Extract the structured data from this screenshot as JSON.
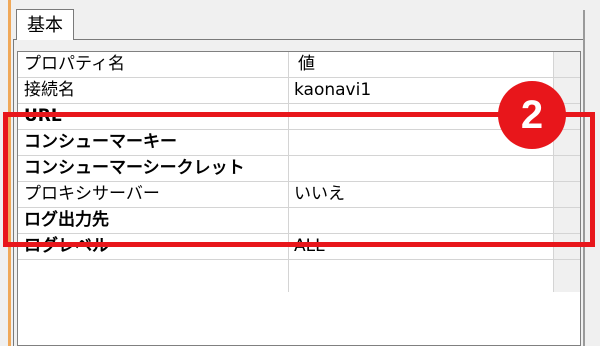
{
  "tab": {
    "label": "基本"
  },
  "header": {
    "name": "プロパティ名",
    "value": "値"
  },
  "rows": [
    {
      "name": "接続名",
      "value": "kaonavi1"
    },
    {
      "name": "URL",
      "value": ""
    },
    {
      "name": "コンシューマーキー",
      "value": ""
    },
    {
      "name": "コンシューマーシークレット",
      "value": ""
    },
    {
      "name": "プロキシサーバー",
      "value": "いいえ"
    },
    {
      "name": "ログ出力先",
      "value": ""
    },
    {
      "name": "ログレベル",
      "value": "ALL"
    }
  ],
  "annotation": {
    "badge": "2",
    "color": "#e8161b"
  }
}
